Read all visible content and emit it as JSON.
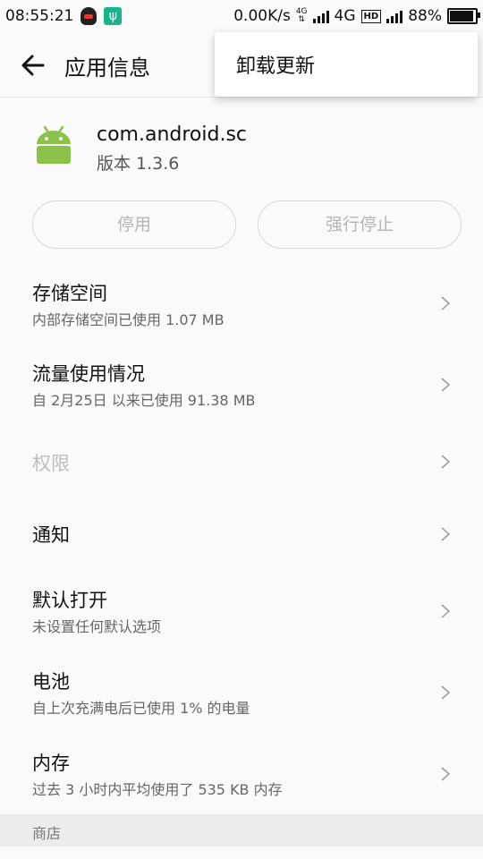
{
  "status_bar": {
    "time": "08:55:21",
    "net_speed": "0.00K/s",
    "sim1_tech": "4G",
    "sim2_tech": "4G",
    "hd_badge": "HD",
    "battery_percent": "88%",
    "battery_level": 0.88,
    "icons": [
      "qq-icon",
      "usb-icon",
      "signal-icon",
      "hd-voice-icon",
      "battery-icon"
    ]
  },
  "header": {
    "title": "应用信息",
    "back_icon": "arrow-left-icon"
  },
  "overflow_menu": {
    "items": [
      "卸载更新"
    ]
  },
  "app": {
    "package": "com.android.sc",
    "version": "版本 1.3.6",
    "icon": "android-robot-icon"
  },
  "actions": {
    "disable": "停用",
    "force_stop": "强行停止"
  },
  "settings": [
    {
      "title": "存储空间",
      "subtitle": "内部存储空间已使用 1.07 MB",
      "enabled": true
    },
    {
      "title": "流量使用情况",
      "subtitle": "自 2月25日 以来已使用 91.38 MB",
      "enabled": true
    },
    {
      "title": "权限",
      "subtitle": "",
      "enabled": false
    },
    {
      "title": "通知",
      "subtitle": "",
      "enabled": true
    },
    {
      "title": "默认打开",
      "subtitle": "未设置任何默认选项",
      "enabled": true
    },
    {
      "title": "电池",
      "subtitle": "自上次充满电后已使用 1% 的电量",
      "enabled": true
    },
    {
      "title": "内存",
      "subtitle": "过去 3 小时内平均使用了 535 KB 内存",
      "enabled": true
    }
  ],
  "store_section": {
    "label": "商店"
  }
}
